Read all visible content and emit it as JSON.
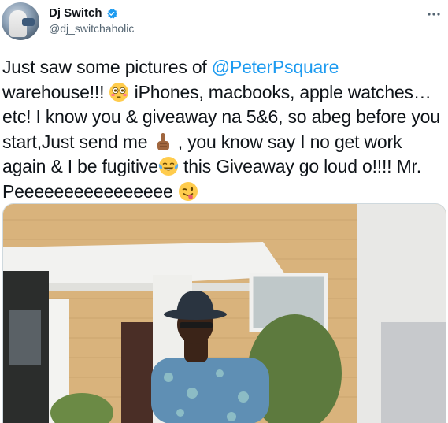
{
  "author": {
    "name": "Dj Switch",
    "handle": "@dj_switchaholic",
    "verified_icon": "verified-badge-icon",
    "avatar_icon": "profile-avatar"
  },
  "menu_icon": "more-options-icon",
  "tweet": {
    "part1": "Just saw some pictures of ",
    "mention": "@PeterPsquare",
    "part2": " warehouse!!! ",
    "part3": " iPhones, macbooks, apple watches… etc! I know you & giveaway na 5&6, so abeg before you start,Just send me ",
    "part4": " , you know say I no get work again & I be fugitive",
    "part5": " this Giveaway go loud o!!!! Mr. Peeeeeeeeeeeeeeee ",
    "emojis": [
      "flushed-face-icon",
      "pointing-up-icon",
      "face-with-tears-of-joy-icon",
      "winking-face-with-tongue-icon"
    ]
  },
  "photo": {
    "icon": "tweet-photo-image"
  },
  "colors": {
    "link": "#1d9bf0",
    "text": "#0f1419",
    "secondary": "#536471",
    "verified": "#1d9bf0"
  }
}
